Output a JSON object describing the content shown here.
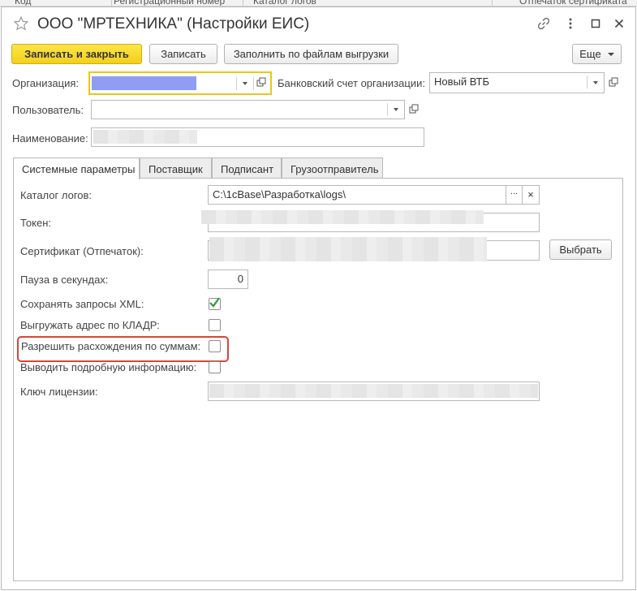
{
  "background_list": {
    "columns": [
      "Код",
      "Регистрационный номер",
      "Каталог логов",
      "Отпечаток сертификата"
    ]
  },
  "window": {
    "title": "ООО \"МРТЕХНИКА\" (Настройки ЕИС)",
    "icons": [
      "star-icon",
      "link-icon",
      "more-vertical-icon",
      "maximize-icon",
      "close-icon"
    ]
  },
  "toolbar": {
    "save_and_close": "Записать и закрыть",
    "save": "Записать",
    "fill_from_files": "Заполнить по файлам выгрузки",
    "more": "Еще"
  },
  "form": {
    "organization_label": "Организация:",
    "organization_value": "",
    "bank_account_label": "Банковский счет организации:",
    "bank_account_value": "Новый ВТБ",
    "user_label": "Пользователь:",
    "user_value": "",
    "name_label": "Наименование:",
    "name_value": ""
  },
  "tabs": [
    {
      "label": "Системные параметры",
      "active": true
    },
    {
      "label": "Поставщик",
      "active": false
    },
    {
      "label": "Подписант",
      "active": false
    },
    {
      "label": "Грузоотправитель",
      "active": false
    }
  ],
  "system": {
    "log_dir_label": "Каталог логов:",
    "log_dir_value": "C:\\1cBase\\Разработка\\logs\\",
    "ellipsis": "...",
    "clear": "×",
    "token_label": "Токен:",
    "certificate_label": "Сертификат (Отпечаток):",
    "select_button": "Выбрать",
    "pause_label": "Пауза в секундах:",
    "pause_value": "0",
    "save_xml_label": "Сохранять запросы XML:",
    "save_xml_checked": true,
    "kladr_label": "Выгружать адрес по КЛАДР:",
    "kladr_checked": false,
    "allow_diff_label": "Разрешить расхождения по суммам:",
    "allow_diff_checked": false,
    "verbose_label": "Выводить подробную информацию:",
    "verbose_checked": false,
    "license_label": "Ключ лицензии:"
  },
  "colors": {
    "accent_yellow": "#f5cf1a",
    "focus_border": "#f0c419",
    "highlight_red": "#d9433a",
    "check_green": "#2e9e3e",
    "org_selection": "#7b8cf0"
  }
}
